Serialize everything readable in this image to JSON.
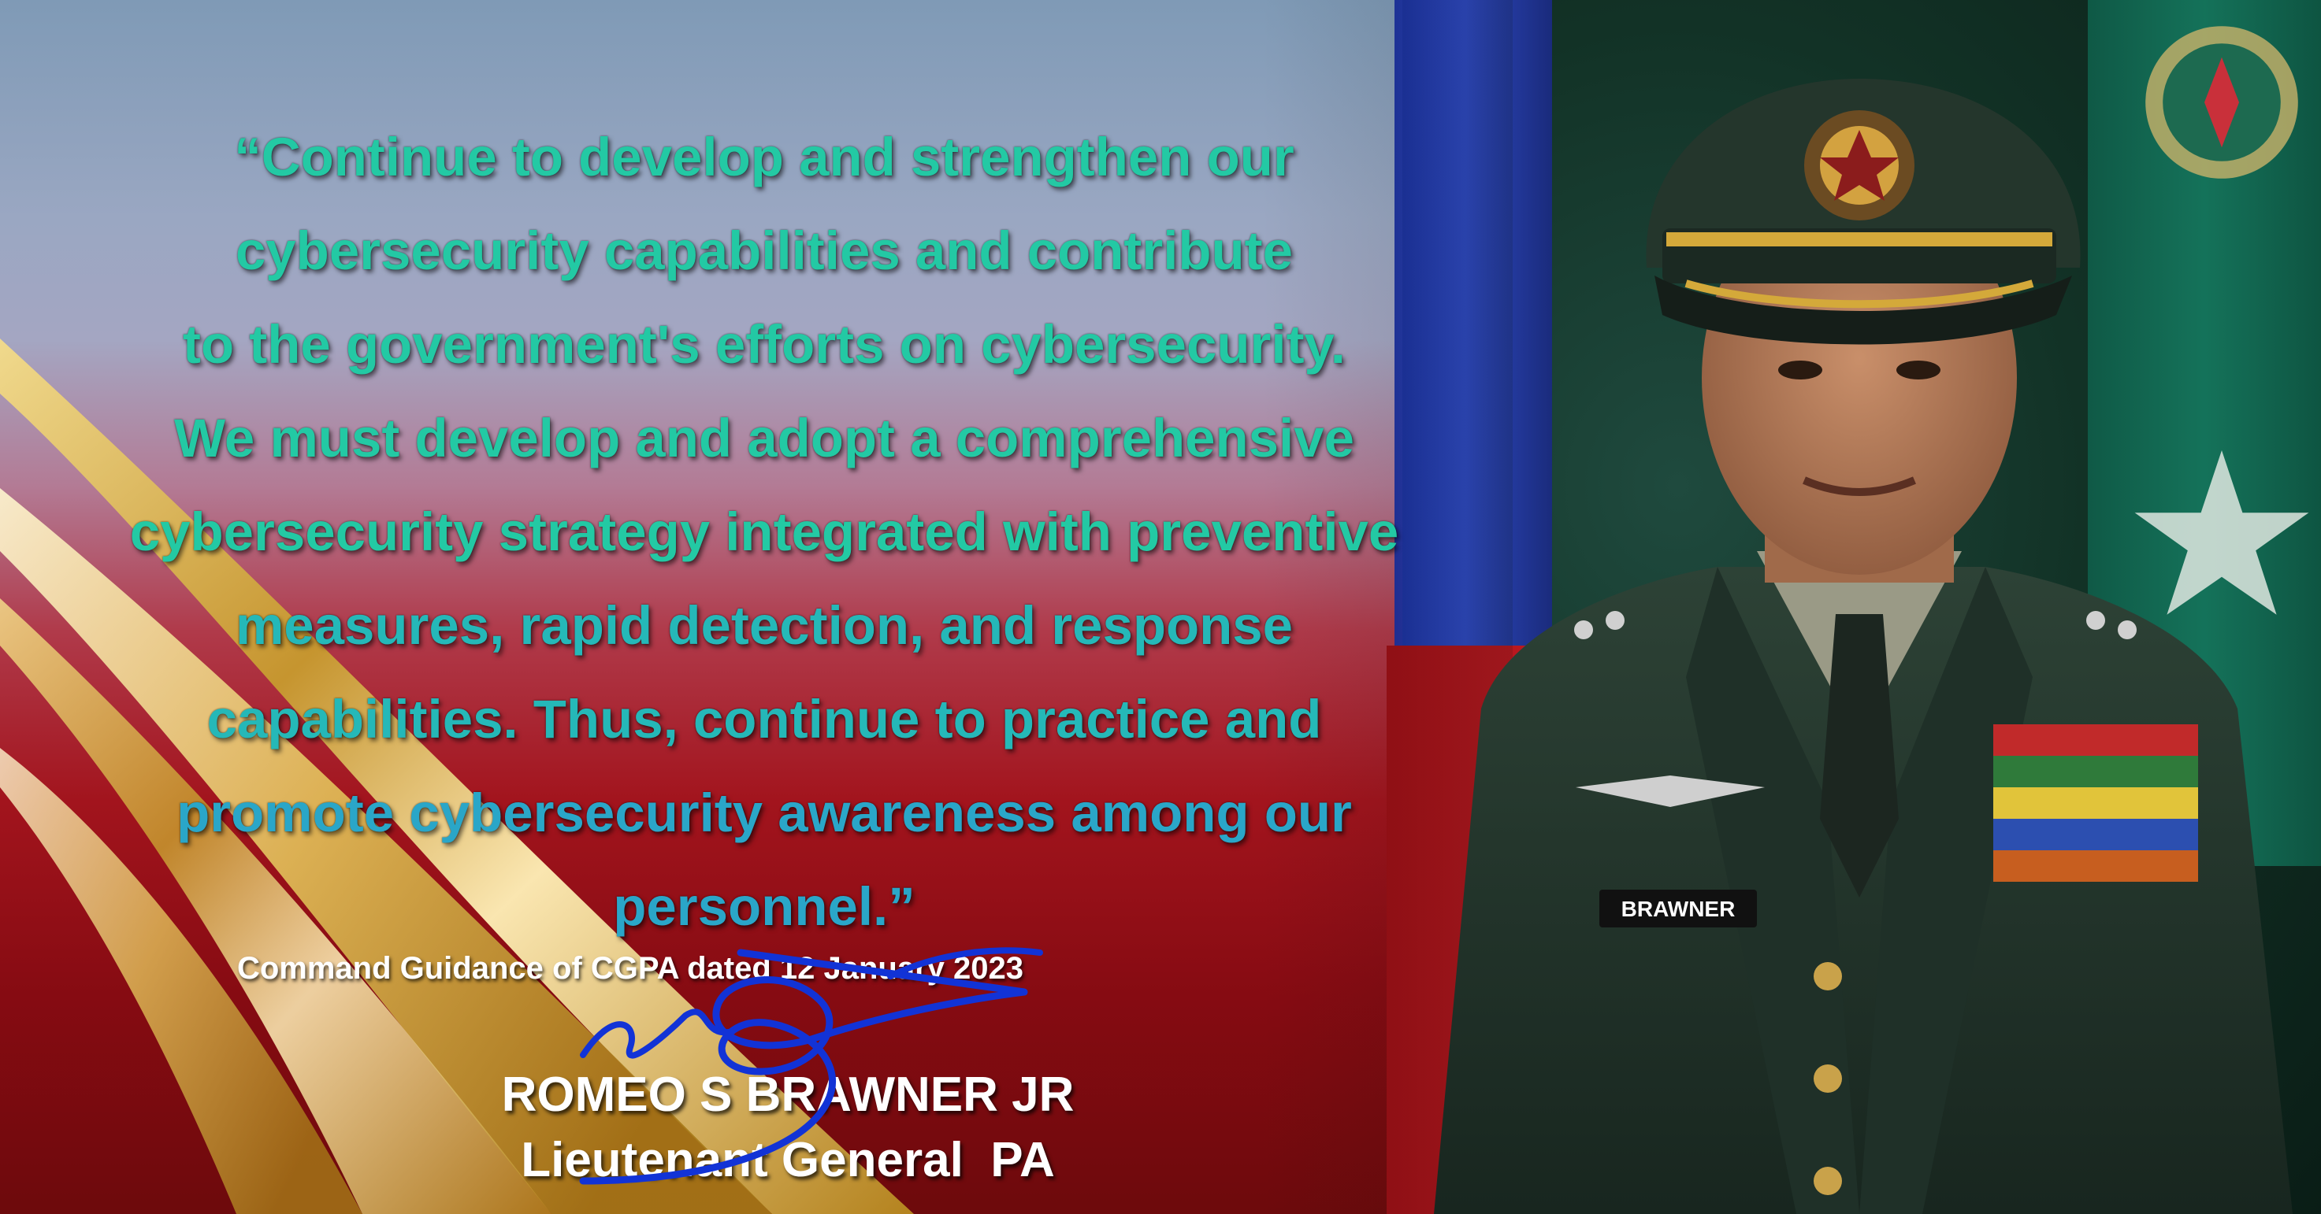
{
  "quote": {
    "lines": [
      "“Continue to develop and strengthen our",
      "cybersecurity capabilities and contribute",
      "to the government's efforts on cybersecurity.",
      "We must develop and adopt a comprehensive",
      "cybersecurity strategy integrated with preventive",
      "measures, rapid detection, and response",
      "capabilities. Thus, continue to practice and",
      "promote cybersecurity awareness among our",
      "personnel.”"
    ]
  },
  "citation": "Command Guidance of CGPA dated 12 January 2023",
  "signatory": {
    "name": "ROMEO S BRAWNER JR",
    "rank": "Lieutenant General  PA",
    "nameplate": "BRAWNER"
  },
  "colors": {
    "quote_text": "#23c9a4",
    "quote_text_alt": "#2aa6c8",
    "gold": "#d9b24a",
    "signature_ink": "#1233d6",
    "uniform": "#23342c"
  },
  "icons": {
    "signature": "handwritten-signature",
    "portrait": "officer-portrait",
    "swoosh": "gold-swoosh-decoration"
  }
}
